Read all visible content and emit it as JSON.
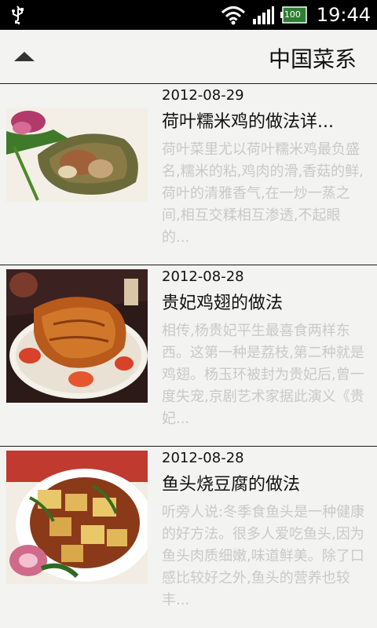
{
  "status_bar": {
    "battery_level": "100",
    "time": "19:44"
  },
  "header": {
    "title": "中国菜系"
  },
  "items": [
    {
      "date": "2012-08-29",
      "title": "荷叶糯米鸡的做法详...",
      "desc": "荷叶菜里尤以荷叶糯米鸡最负盛名,糯米的粘,鸡肉的滑,香菇的鲜,荷叶的清雅香气,在一炒一蒸之间,相互交糅相互渗透,不起眼的..."
    },
    {
      "date": "2012-08-28",
      "title": "贵妃鸡翅的做法",
      "desc": "相传,杨贵妃平生最喜食两样东西。这第一种是荔枝,第二种就是鸡翅。杨玉环被封为贵妃后,曾一度失宠,京剧艺术家据此演义《贵妃..."
    },
    {
      "date": "2012-08-28",
      "title": "鱼头烧豆腐的做法",
      "desc": "听旁人说:冬季食鱼头是一种健康的好方法。很多人爱吃鱼头,因为鱼头肉质细嫩,味道鲜美。除了口感比较好之外,鱼头的营养也较丰..."
    }
  ]
}
